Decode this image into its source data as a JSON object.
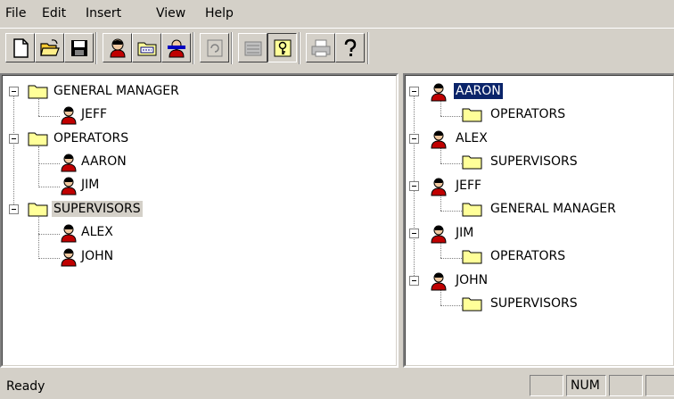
{
  "menu": {
    "items": [
      "File",
      "Edit",
      "Insert",
      "View",
      "Help"
    ]
  },
  "toolbar": {
    "buttons": [
      "new-document",
      "open-folder",
      "save-disk",
      "add-user",
      "add-group",
      "delete-user",
      "refresh",
      "group-properties",
      "keys",
      "print",
      "help"
    ]
  },
  "left_tree": {
    "groups": [
      {
        "label": "GENERAL MANAGER",
        "users": [
          "JEFF"
        ]
      },
      {
        "label": "OPERATORS",
        "users": [
          "AARON",
          "JIM"
        ]
      },
      {
        "label": "SUPERVISORS",
        "users": [
          "ALEX",
          "JOHN"
        ]
      }
    ]
  },
  "right_tree": {
    "users": [
      {
        "label": "AARON",
        "group": "OPERATORS"
      },
      {
        "label": "ALEX",
        "group": "SUPERVISORS"
      },
      {
        "label": "JEFF",
        "group": "GENERAL MANAGER"
      },
      {
        "label": "JIM",
        "group": "OPERATORS"
      },
      {
        "label": "JOHN",
        "group": "SUPERVISORS"
      }
    ]
  },
  "status": {
    "text": "Ready",
    "num": "NUM"
  },
  "colors": {
    "selection": "#0a246a",
    "folder": "#ffff99",
    "chrome": "#d4d0c8"
  }
}
